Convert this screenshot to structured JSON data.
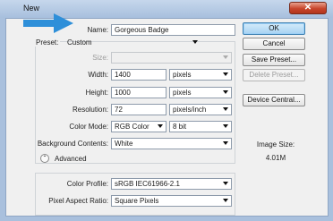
{
  "window": {
    "title": "New",
    "close_glyph": "✕"
  },
  "form": {
    "name": {
      "label": "Name:",
      "value": "Gorgeous Badge"
    },
    "preset": {
      "label": "Preset:",
      "value": "Custom"
    },
    "size": {
      "label": "Size:",
      "value": ""
    },
    "width": {
      "label": "Width:",
      "value": "1400",
      "unit": "pixels"
    },
    "height": {
      "label": "Height:",
      "value": "1000",
      "unit": "pixels"
    },
    "resolution": {
      "label": "Resolution:",
      "value": "72",
      "unit": "pixels/inch"
    },
    "color_mode": {
      "label": "Color Mode:",
      "value": "RGB Color",
      "depth": "8 bit"
    },
    "background": {
      "label": "Background Contents:",
      "value": "White"
    },
    "advanced": {
      "label": "Advanced",
      "toggle_glyph": "⌃"
    },
    "color_profile": {
      "label": "Color Profile:",
      "value": "sRGB IEC61966-2.1"
    },
    "pixel_aspect": {
      "label": "Pixel Aspect Ratio:",
      "value": "Square Pixels"
    }
  },
  "buttons": {
    "ok": "OK",
    "cancel": "Cancel",
    "save_preset": "Save Preset...",
    "delete_preset": "Delete Preset...",
    "device_central": "Device Central..."
  },
  "info": {
    "image_size_label": "Image Size:",
    "image_size_value": "4.01M"
  },
  "colors": {
    "arrow": "#2e8fd9",
    "primary_button": "#a6d2f2"
  }
}
